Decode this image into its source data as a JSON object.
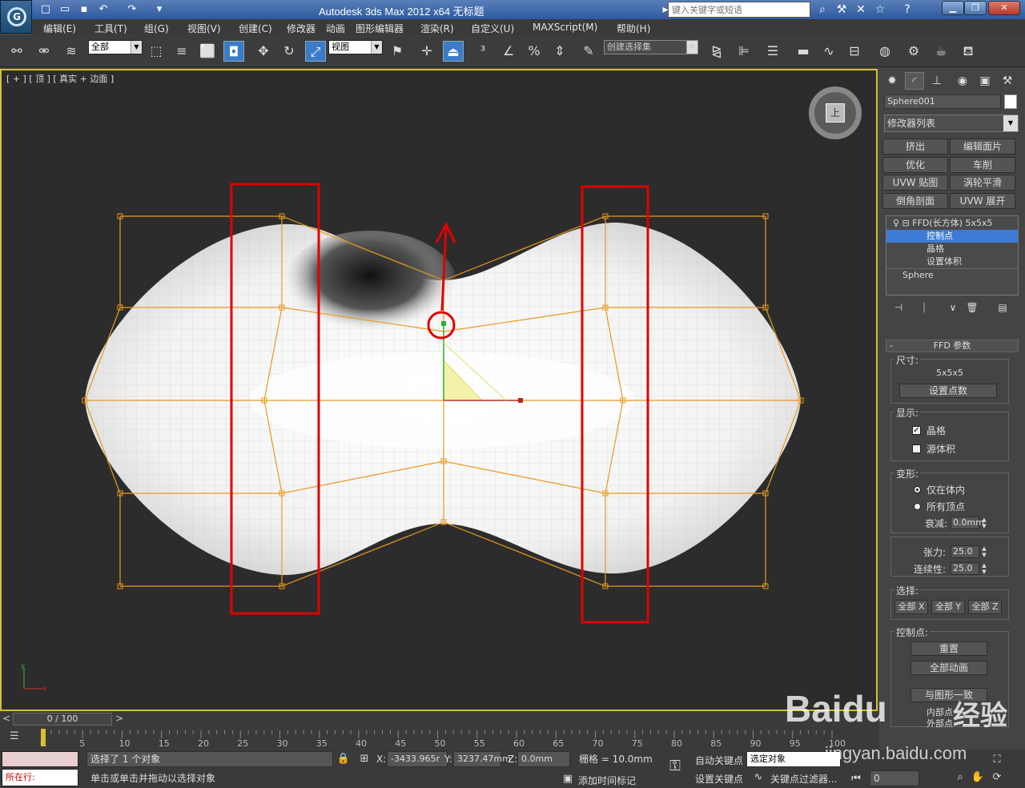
{
  "titlebar": {
    "title": "Autodesk 3ds Max  2012 x64      无标题",
    "search_placeholder": "键入关键字或短语",
    "logo": "G"
  },
  "menus": [
    "编辑(E)",
    "工具(T)",
    "组(G)",
    "视图(V)",
    "创建(C)",
    "修改器",
    "动画",
    "图形编辑器",
    "渲染(R)",
    "自定义(U)",
    "MAXScript(M)",
    "帮助(H)"
  ],
  "toolbar": {
    "filter_value": "全部",
    "refcoord_value": "视图",
    "selection_set_placeholder": "创建选择集"
  },
  "viewport": {
    "label": "[ + ] [ 顶 ] [ 真实 + 边面 ]",
    "viewcube_face": "上"
  },
  "command_panel": {
    "object_name": "Sphere001",
    "object_color": "#ffffff",
    "modifier_list": "修改器列表",
    "mod_buttons": [
      "挤出",
      "编辑面片",
      "优化",
      "车削",
      "UVW 贴图",
      "涡轮平滑",
      "倒角剖面",
      "UVW 展开"
    ],
    "stack": {
      "ffd": "FFD(长方体) 5x5x5",
      "control_points": "控制点",
      "lattice": "晶格",
      "set_volume": "设置体积",
      "sphere": "Sphere"
    },
    "rollout_title": "FFD 参数",
    "dimensions": {
      "title": "尺寸:",
      "value": "5x5x5",
      "set_points": "设置点数"
    },
    "display": {
      "title": "显示:",
      "lattice": "晶格",
      "lattice_checked": true,
      "source_volume": "源体积"
    },
    "deform": {
      "title": "变形:",
      "only_in_volume": "仅在体内",
      "all_vertices": "所有顶点",
      "falloff_label": "衰减:",
      "falloff_value": "0.0mm",
      "tension_label": "张力:",
      "tension_value": "25.0",
      "continuity_label": "连续性:",
      "continuity_value": "25.0"
    },
    "selection": {
      "title": "选择:",
      "all_x": "全部 X",
      "all_y": "全部 Y",
      "all_z": "全部 Z"
    },
    "control_points": {
      "title": "控制点:",
      "reset": "重置",
      "animate_all": "全部动画",
      "conform": "与图形一致",
      "inner_points": "内部点",
      "outer_points": "外部点"
    }
  },
  "time": {
    "slider": "0 / 100",
    "ticks": [
      "0",
      "5",
      "10",
      "15",
      "20",
      "25",
      "30",
      "35",
      "40",
      "45",
      "50",
      "55",
      "60",
      "65",
      "70",
      "75",
      "80",
      "85",
      "90",
      "95",
      "100"
    ]
  },
  "status": {
    "script_prompt": "所在行:",
    "selected": "选择了 1 个对象",
    "hint": "单击或单击并拖动以选择对象",
    "x_label": "X:",
    "x_value": "-3433.965r",
    "y_label": "Y:",
    "y_value": "3237.47mm",
    "z_label": "Z:",
    "z_value": "0.0mm",
    "grid": "栅格 = 10.0mm",
    "add_time_tag": "添加时间标记",
    "auto_key": "自动关键点",
    "set_key": "设置关键点",
    "selected_object": "选定对象",
    "key_filters": "关键点过滤器...",
    "frame": "0"
  },
  "watermark": {
    "brand": "Baidu",
    "sub": "经验",
    "url": "jingyan.baidu.com"
  },
  "colors": {
    "accent": "#3a7cc8",
    "highlight_box": "#e00000",
    "lattice": "#e89a1e",
    "active_viewport_border": "#d6c032"
  }
}
